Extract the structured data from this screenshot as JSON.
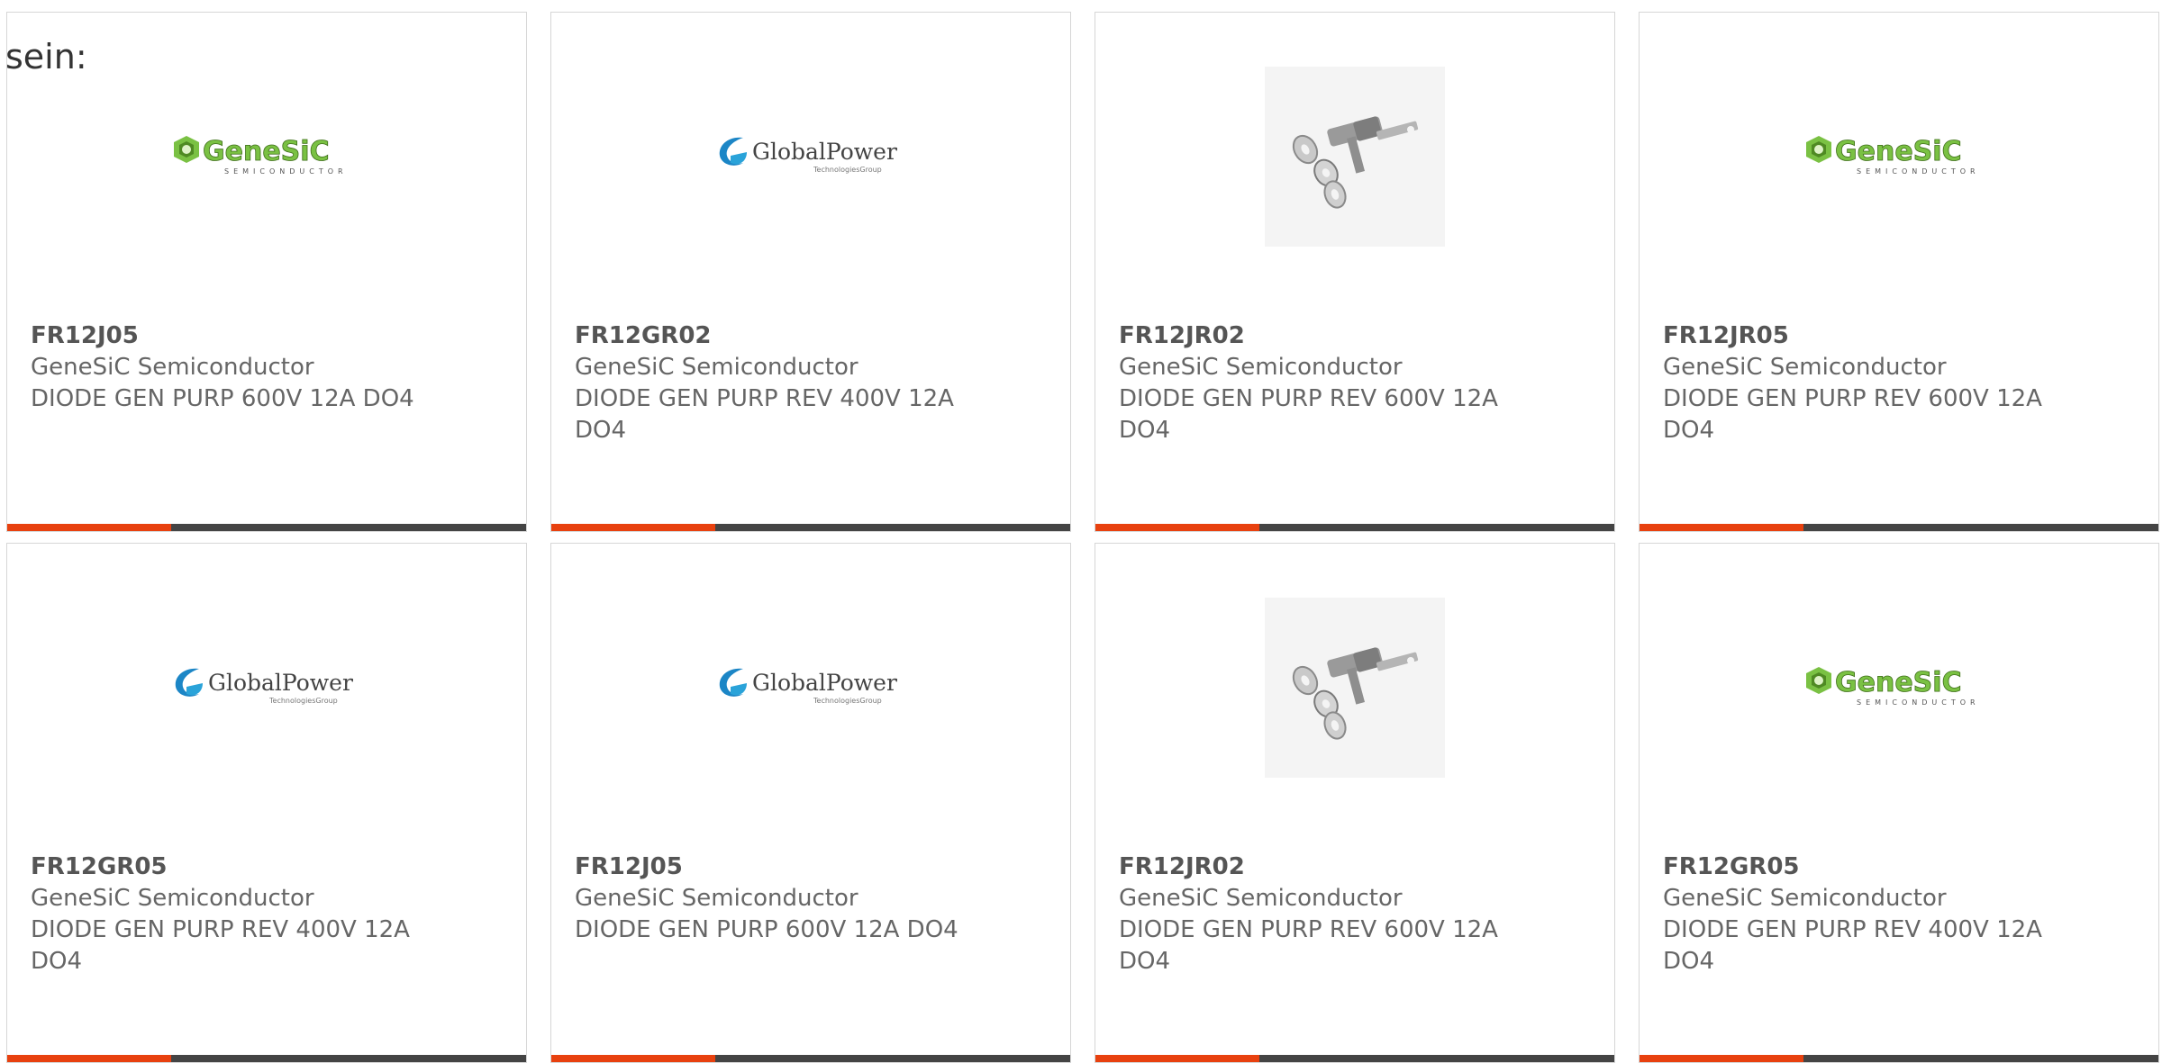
{
  "page": {
    "label": "sein:"
  },
  "colors": {
    "accent": "#e8410f",
    "bar": "#444444",
    "border": "#d6d6d6",
    "text": "#666666",
    "genesic_green": "#7ac143",
    "globalpower_blue": "#1c86c6"
  },
  "products": [
    {
      "part": "FR12J05",
      "manufacturer": "GeneSiC Semiconductor",
      "description": "DIODE GEN PURP 600V 12A DO4",
      "image": "genesic-logo",
      "logo": {
        "name": "GeneSiC",
        "sub": "SEMICONDUCTOR"
      }
    },
    {
      "part": "FR12GR02",
      "manufacturer": "GeneSiC Semiconductor",
      "description": "DIODE GEN PURP REV 400V 12A DO4",
      "image": "globalpower-logo",
      "logo": {
        "name": "GlobalPower",
        "sub": "TechnologiesGroup"
      }
    },
    {
      "part": "FR12JR02",
      "manufacturer": "GeneSiC Semiconductor",
      "description": "DIODE GEN PURP REV 600V 12A DO4",
      "image": "stud-diode-photo",
      "logo": null
    },
    {
      "part": "FR12JR05",
      "manufacturer": "GeneSiC Semiconductor",
      "description": "DIODE GEN PURP REV 600V 12A DO4",
      "image": "genesic-logo",
      "logo": {
        "name": "GeneSiC",
        "sub": "SEMICONDUCTOR"
      }
    },
    {
      "part": "FR12GR05",
      "manufacturer": "GeneSiC Semiconductor",
      "description": "DIODE GEN PURP REV 400V 12A DO4",
      "image": "globalpower-logo",
      "logo": {
        "name": "GlobalPower",
        "sub": "TechnologiesGroup"
      }
    },
    {
      "part": "FR12J05",
      "manufacturer": "GeneSiC Semiconductor",
      "description": "DIODE GEN PURP 600V 12A DO4",
      "image": "globalpower-logo",
      "logo": {
        "name": "GlobalPower",
        "sub": "TechnologiesGroup"
      }
    },
    {
      "part": "FR12JR02",
      "manufacturer": "GeneSiC Semiconductor",
      "description": "DIODE GEN PURP REV 600V 12A DO4",
      "image": "stud-diode-photo",
      "logo": null
    },
    {
      "part": "FR12GR05",
      "manufacturer": "GeneSiC Semiconductor",
      "description": "DIODE GEN PURP REV 400V 12A DO4",
      "image": "genesic-logo",
      "logo": {
        "name": "GeneSiC",
        "sub": "SEMICONDUCTOR"
      }
    }
  ]
}
